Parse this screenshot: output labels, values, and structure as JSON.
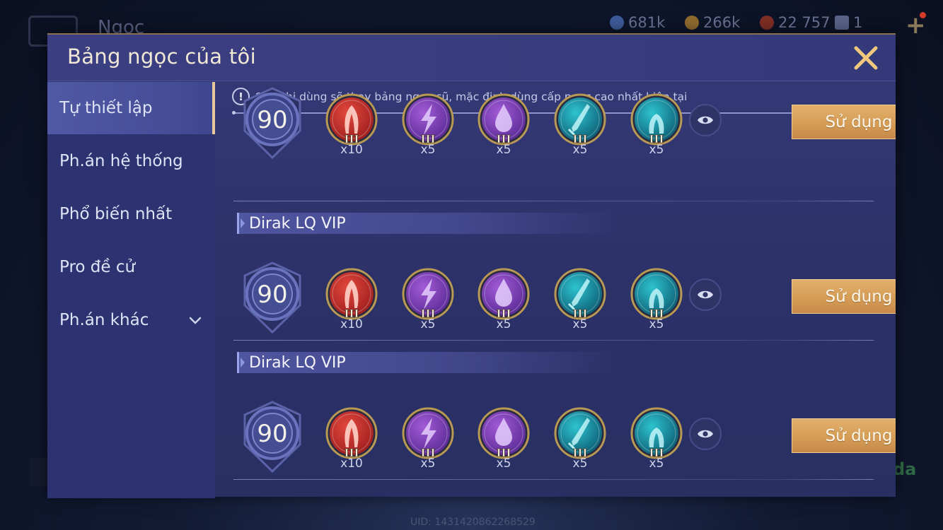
{
  "background": {
    "title": "Ngọc",
    "currencies": [
      {
        "icon": "coin-blue-icon",
        "value": "681k",
        "color": "#5a78c8"
      },
      {
        "icon": "coin-gold-icon",
        "value": "266k",
        "color": "#c98a2a"
      },
      {
        "icon": "gem-red-icon",
        "value": "22 757",
        "color": "#b23a2a"
      },
      {
        "icon": "card-icon",
        "value": "1",
        "color": "#7a8ab0"
      }
    ],
    "plus_label": "+",
    "uid": "UID: 1431420862268529",
    "side_text": "da"
  },
  "dialog": {
    "title": "Bảng ngọc của tôi",
    "close_icon": "close-icon"
  },
  "sidebar": {
    "items": [
      {
        "label": "Tự thiết lập",
        "active": true
      },
      {
        "label": "Ph.án hệ thống",
        "active": false
      },
      {
        "label": "Phổ biến nhất",
        "active": false
      },
      {
        "label": "Pro đề cử",
        "active": false
      },
      {
        "label": "Ph.án khác",
        "active": false,
        "expandable": true
      }
    ]
  },
  "content": {
    "notice": "Sau khi dùng sẽ thay bảng ngọc cũ, mặc định dùng cấp ngọc cao nhất hiện tại",
    "sets": [
      {
        "name": "",
        "level": "90",
        "gems": [
          {
            "type": "red",
            "tier": "III",
            "count": "x10"
          },
          {
            "type": "purple-lightning",
            "tier": "III",
            "count": "x5"
          },
          {
            "type": "purple-drop",
            "tier": "III",
            "count": "x5"
          },
          {
            "type": "teal-blade",
            "tier": "III",
            "count": "x5"
          },
          {
            "type": "teal-arch",
            "tier": "III",
            "count": "x5"
          }
        ],
        "use_label": "Sử dụng"
      },
      {
        "name": "Dirak LQ VIP",
        "level": "90",
        "gems": [
          {
            "type": "red",
            "tier": "III",
            "count": "x10"
          },
          {
            "type": "purple-lightning",
            "tier": "III",
            "count": "x5"
          },
          {
            "type": "purple-drop",
            "tier": "III",
            "count": "x5"
          },
          {
            "type": "teal-blade",
            "tier": "III",
            "count": "x5"
          },
          {
            "type": "teal-arch",
            "tier": "III",
            "count": "x5"
          }
        ],
        "use_label": "Sử dụng"
      },
      {
        "name": "Dirak LQ VIP",
        "level": "90",
        "gems": [
          {
            "type": "red",
            "tier": "III",
            "count": "x10"
          },
          {
            "type": "purple-lightning",
            "tier": "III",
            "count": "x5"
          },
          {
            "type": "purple-drop",
            "tier": "III",
            "count": "x5"
          },
          {
            "type": "teal-blade",
            "tier": "III",
            "count": "x5"
          },
          {
            "type": "teal-arch",
            "tier": "III",
            "count": "x5"
          }
        ],
        "use_label": "Sử dụng"
      }
    ]
  },
  "colors": {
    "accent_gold": "#e7c89a",
    "button": "#d59d56",
    "panel": "#353a78"
  }
}
